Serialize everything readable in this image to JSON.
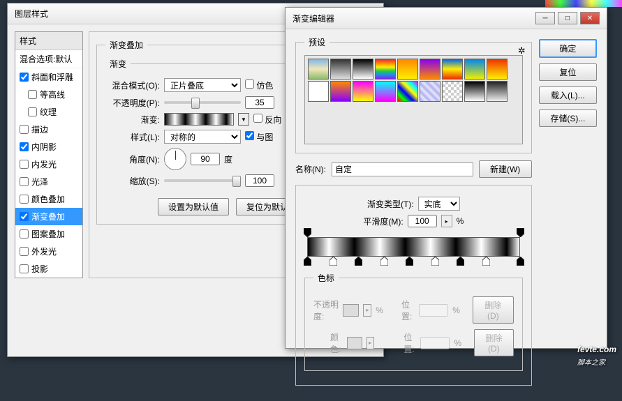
{
  "layerStyle": {
    "title": "图层样式",
    "stylesHeader": "样式",
    "blendHeader": "混合选项:默认",
    "items": [
      {
        "label": "斜面和浮雕",
        "checked": true,
        "indent": false
      },
      {
        "label": "等高线",
        "checked": false,
        "indent": true
      },
      {
        "label": "纹理",
        "checked": false,
        "indent": true
      },
      {
        "label": "描边",
        "checked": false,
        "indent": false
      },
      {
        "label": "内阴影",
        "checked": true,
        "indent": false
      },
      {
        "label": "内发光",
        "checked": false,
        "indent": false
      },
      {
        "label": "光泽",
        "checked": false,
        "indent": false
      },
      {
        "label": "颜色叠加",
        "checked": false,
        "indent": false
      },
      {
        "label": "渐变叠加",
        "checked": true,
        "indent": false,
        "active": true
      },
      {
        "label": "图案叠加",
        "checked": false,
        "indent": false
      },
      {
        "label": "外发光",
        "checked": false,
        "indent": false
      },
      {
        "label": "投影",
        "checked": false,
        "indent": false
      }
    ],
    "panel": {
      "legend": "渐变叠加",
      "sublegend": "渐变",
      "blendModeLabel": "混合模式(O):",
      "blendModeValue": "正片叠底",
      "ditherLabel": "仿色",
      "opacityLabel": "不透明度(P):",
      "opacityValue": "35",
      "gradientLabel": "渐变:",
      "reverseLabel": "反向",
      "styleLabel": "样式(L):",
      "styleValue": "对称的",
      "alignLabel": "与图",
      "angleLabel": "角度(N):",
      "angleValue": "90",
      "angleUnit": "度",
      "scaleLabel": "缩放(S):",
      "scaleValue": "100",
      "btnDefault": "设置为默认值",
      "btnReset": "复位为默认值"
    }
  },
  "gradEditor": {
    "title": "渐变编辑器",
    "presetsLegend": "预设",
    "swatches": [
      "linear-gradient(#7fb8e8,#f0e6b8,#8fbd6f)",
      "linear-gradient(#333,#ddd)",
      "linear-gradient(#000,#fff)",
      "linear-gradient(#e24,#f80,#fe0,#2c4,#28e,#82e)",
      "linear-gradient(#f80,#fe0)",
      "linear-gradient(#80e,#f80)",
      "linear-gradient(#06e,#fe0,#e30)",
      "linear-gradient(#08e,#ee0)",
      "linear-gradient(#e30,#fe0)",
      "#fff",
      "linear-gradient(#f80,#80f)",
      "linear-gradient(#f0f,#ff0)",
      "linear-gradient(#0ff,#f0f)",
      "linear-gradient(45deg,#f00,#0f0,#00f,#ff0,#0ff,#f0f)",
      "repeating-linear-gradient(45deg,#bbe,#bbe 4px,#ddf 4px,#ddf 8px)",
      "repeating-conic-gradient(#ccc 0 25%,#fff 0 50%)",
      "linear-gradient(#000,#fff)",
      "linear-gradient(#222,#eee)"
    ],
    "buttons": {
      "ok": "确定",
      "reset": "复位",
      "load": "载入(L)...",
      "save": "存储(S)..."
    },
    "nameLabel": "名称(N):",
    "nameValue": "自定",
    "newBtn": "新建(W)",
    "typeLabel": "渐变类型(T):",
    "typeValue": "实底",
    "smoothLabel": "平滑度(M):",
    "smoothValue": "100",
    "percent": "%",
    "colorStopsLegend": "色标",
    "stop": {
      "opacityLabel": "不透明度:",
      "positionLabel": "位置:",
      "deleteLabel": "删除(D)",
      "colorLabel": "颜色:"
    },
    "topStops": [
      0,
      100
    ],
    "bottomStops": [
      0,
      12,
      24,
      36,
      48,
      60,
      72,
      84,
      100
    ]
  },
  "watermark": {
    "main": "fevte.com",
    "sub": "脚本之家"
  }
}
